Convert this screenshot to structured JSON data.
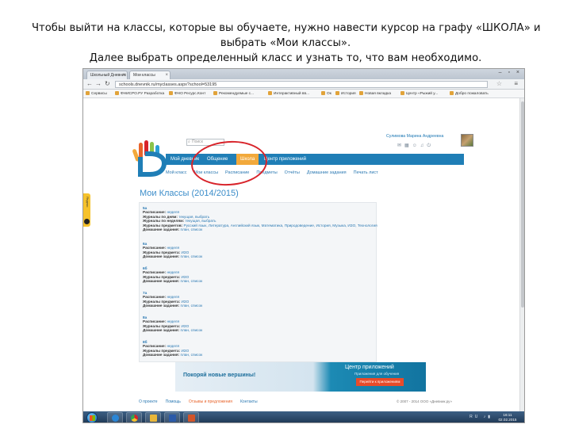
{
  "caption": {
    "line1": "Чтобы выйти на классы, которые вы обучаете, нужно навести курсор на графу «ШКОЛА» и",
    "line2": "выбрать «Мои классы».",
    "line3": "Далее выбрать определенный класс и узнать то, что вам необходимо."
  },
  "browser": {
    "tabs": [
      {
        "label": "Школьный Дневник"
      },
      {
        "label": "Мои классы"
      }
    ],
    "url": "schools.dnevnik.ru/myclasses.aspx?school=53195",
    "bookmarks": [
      "Сервисы",
      "ФНИСРО.РУ Разработка",
      "ФНО Ресурс.Конт",
      "Рекомендуемые с...",
      "Интерактивный вв...",
      "Ок",
      "История",
      "Новая вкладка",
      "Центр «Рыжий у...",
      "Добро пожаловать"
    ]
  },
  "site": {
    "search_placeholder": "Поиск",
    "user_name": "Сулимова Марина Андреевна",
    "top_nav": [
      {
        "label": "Мой дневник"
      },
      {
        "label": "Общение"
      },
      {
        "label": "Школа"
      },
      {
        "label": "Центр приложений"
      }
    ],
    "sub_nav": [
      "Мой класс",
      "Мои классы",
      "Расписание",
      "Предметы",
      "Отчёты",
      "Домашние задания",
      "Печать лист"
    ],
    "page_title": "Мои Классы (2014/2015)"
  },
  "classes": [
    {
      "name": "5а",
      "lines": [
        {
          "label": "Расписание:",
          "value": "неделя"
        },
        {
          "label": "Журналы по дням:",
          "value": "текущая, выбрать"
        },
        {
          "label": "Журналы по неделям:",
          "value": "текущая, выбрать"
        },
        {
          "label": "Журналы предметов:",
          "value": "Русский язык, Литература, Английский язык, Математика, Природоведение, История, Музыка, ИЗО, Технология"
        },
        {
          "label": "Домашние задания:",
          "value": "план, список"
        }
      ]
    },
    {
      "name": "6а",
      "lines": [
        {
          "label": "Расписание:",
          "value": "неделя"
        },
        {
          "label": "Журналы предмета:",
          "value": "ИЗО"
        },
        {
          "label": "Домашние задания:",
          "value": "план, список"
        }
      ]
    },
    {
      "name": "6б",
      "lines": [
        {
          "label": "Расписание:",
          "value": "неделя"
        },
        {
          "label": "Журналы предмета:",
          "value": "ИЗО"
        },
        {
          "label": "Домашние задания:",
          "value": "план, список"
        }
      ]
    },
    {
      "name": "7а",
      "lines": [
        {
          "label": "Расписание:",
          "value": "неделя"
        },
        {
          "label": "Журналы предмета:",
          "value": "ИЗО"
        },
        {
          "label": "Домашние задания:",
          "value": "план, список"
        }
      ]
    },
    {
      "name": "8а",
      "lines": [
        {
          "label": "Расписание:",
          "value": "неделя"
        },
        {
          "label": "Журналы предмета:",
          "value": "ИЗО"
        },
        {
          "label": "Домашние задания:",
          "value": "план, список"
        }
      ]
    },
    {
      "name": "8б",
      "lines": [
        {
          "label": "Расписание:",
          "value": "неделя"
        },
        {
          "label": "Журналы предмета:",
          "value": "ИЗО"
        },
        {
          "label": "Домашние задания:",
          "value": "план, список"
        }
      ]
    }
  ],
  "banner": {
    "slogan": "Покоряй новые вершины!",
    "headline": "Центр приложений",
    "sub": "Приложения для обучения",
    "button": "Перейти к приложениям"
  },
  "footer": {
    "links": [
      "О проекте",
      "Помощь",
      "Отзывы и предложения",
      "Контакты"
    ],
    "copyright": "© 2007 - 2014 ООО «Дневник.ру»"
  },
  "yandex_widget": {
    "label": "Яндекс"
  },
  "taskbar": {
    "tray": "RU",
    "time": "16:11",
    "date": "02.02.2015"
  },
  "colors": {
    "nav_blue": "#1f7eb6",
    "nav_active": "#f2a93b",
    "highlight_red": "#d8232a",
    "link_blue": "#2a78b2"
  }
}
